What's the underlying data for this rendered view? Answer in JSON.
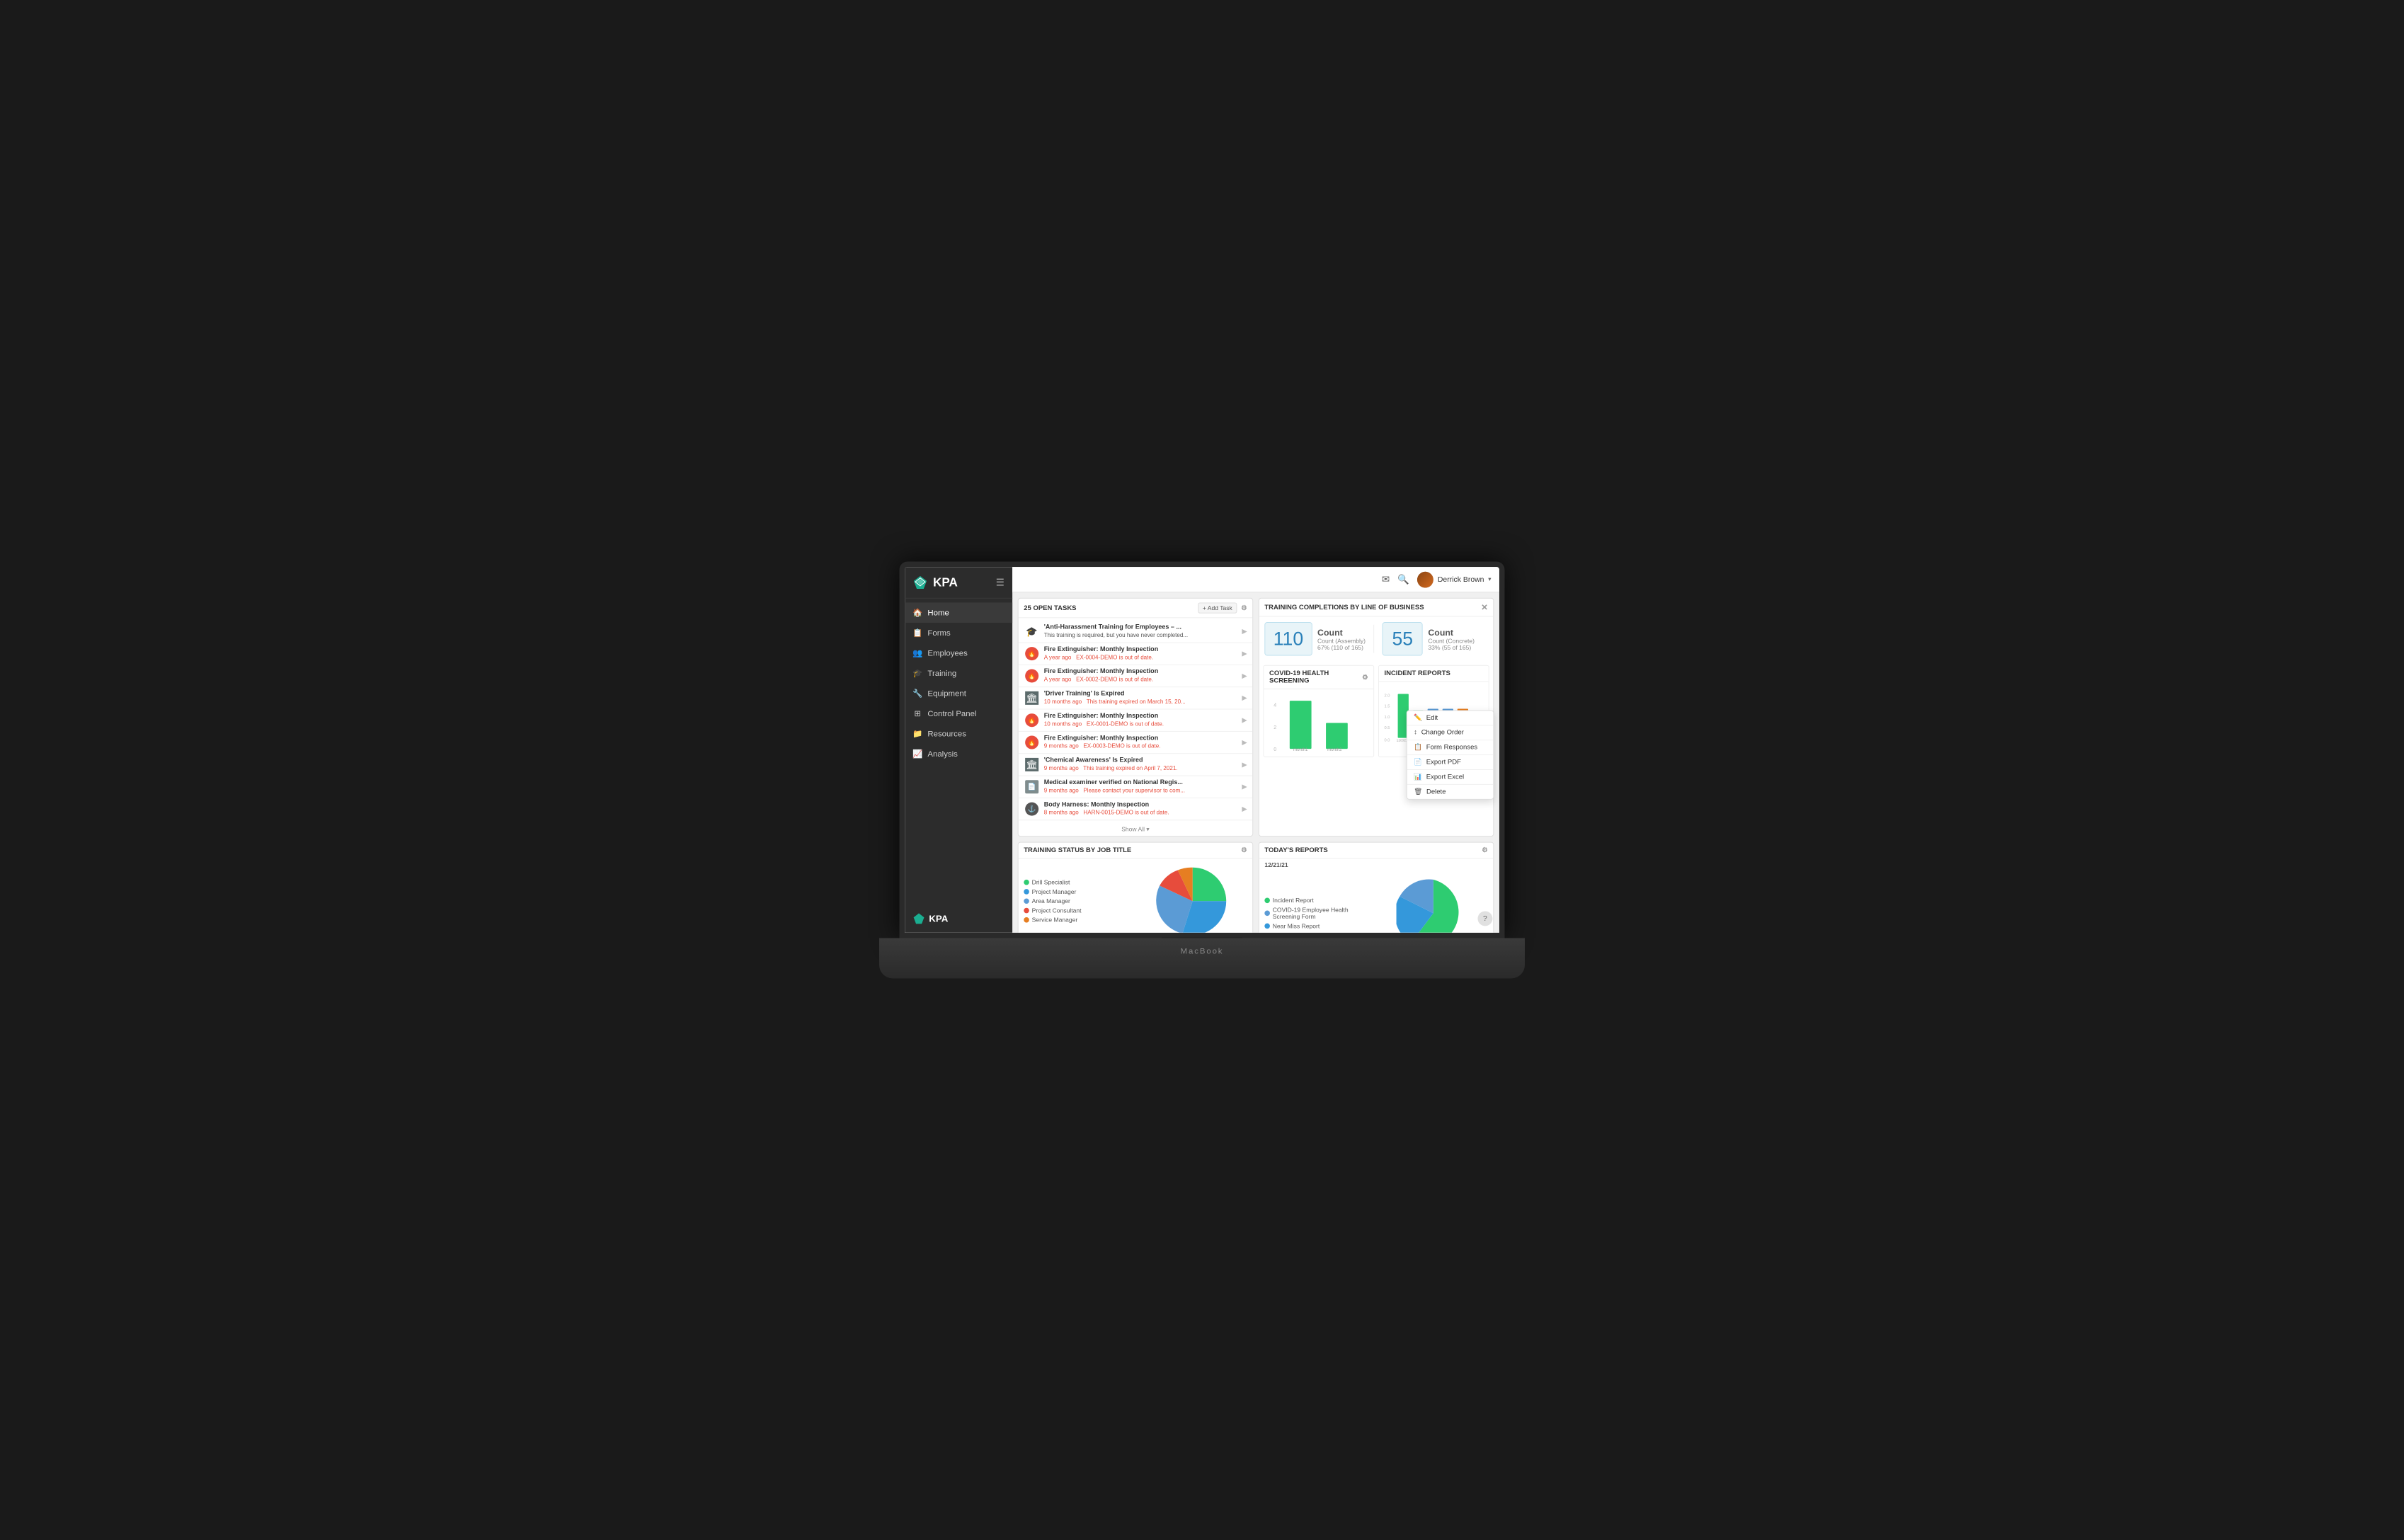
{
  "app": {
    "title": "KPA"
  },
  "header": {
    "user_name": "Derrick Brown",
    "dropdown_arrow": "▾"
  },
  "sidebar": {
    "items": [
      {
        "label": "Home",
        "icon": "🏠",
        "active": true
      },
      {
        "label": "Forms",
        "icon": "📋",
        "active": false
      },
      {
        "label": "Employees",
        "icon": "👥",
        "active": false
      },
      {
        "label": "Training",
        "icon": "🎓",
        "active": false
      },
      {
        "label": "Equipment",
        "icon": "🔧",
        "active": false
      },
      {
        "label": "Control Panel",
        "icon": "⚙️",
        "active": false
      },
      {
        "label": "Resources",
        "icon": "📁",
        "active": false
      },
      {
        "label": "Analysis",
        "icon": "📈",
        "active": false
      }
    ]
  },
  "tasks_widget": {
    "title": "25 OPEN TASKS",
    "add_task_label": "+ Add Task",
    "tasks": [
      {
        "title": "'Anti-Harassment Training for Employees – ...",
        "subtitle": "This training is required, but you have never completed...",
        "icon_type": "training"
      },
      {
        "title": "Fire Extinguisher: Monthly Inspection",
        "subtitle": "A year ago  EX-0004-DEMO is out of date.",
        "icon_type": "fire"
      },
      {
        "title": "Fire Extinguisher: Monthly Inspection",
        "subtitle": "A year ago  EX-0002-DEMO is out of date.",
        "icon_type": "fire"
      },
      {
        "title": "'Driver Training' Is Expired",
        "subtitle": "10 months ago  This training expired on March 15, 20...",
        "icon_type": "building"
      },
      {
        "title": "Fire Extinguisher: Monthly Inspection",
        "subtitle": "10 months ago  EX-0001-DEMO is out of date.",
        "icon_type": "fire"
      },
      {
        "title": "Fire Extinguisher: Monthly Inspection",
        "subtitle": "9 months ago  EX-0003-DEMO is out of date.",
        "icon_type": "fire"
      },
      {
        "title": "'Chemical Awareness' Is Expired",
        "subtitle": "9 months ago  This training expired on April 7, 2021.",
        "icon_type": "building"
      },
      {
        "title": "Medical examiner verified on National Regis...",
        "subtitle": "9 months ago  Please contact your supervisor to com...",
        "icon_type": "doc"
      },
      {
        "title": "Body Harness: Monthly Inspection",
        "subtitle": "8 months ago  HARN-0015-DEMO is out of date.",
        "icon_type": "harness"
      }
    ],
    "show_all_label": "Show All ▾"
  },
  "training_completions": {
    "title": "TRAINING COMPLETIONS BY LINE OF BUSINESS",
    "card1": {
      "number": "110",
      "label": "Count",
      "sub1": "Count (Assembly)",
      "sub2": "67% (110 of 165)"
    },
    "card2": {
      "number": "55",
      "label": "Count",
      "sub1": "Count (Concrete)",
      "sub2": "33% (55 of 165)"
    }
  },
  "covid_widget": {
    "title": "COVID-19 HEALTH SCREENING",
    "bars": [
      {
        "label": "month1",
        "value": 85,
        "color": "#2ecc71"
      },
      {
        "label": "month2",
        "value": 40,
        "color": "#2ecc71"
      }
    ],
    "y_labels": [
      "0",
      "2",
      "4"
    ]
  },
  "incident_widget": {
    "title": "INCIDENT REPORTS",
    "bars": [
      {
        "label": "12/2/21",
        "value": 100,
        "color": "#2ecc71"
      },
      {
        "label": "1/2/21",
        "value": 50,
        "color": "#2ecc71"
      },
      {
        "label": "11/2/21",
        "value": 55,
        "color": "#5b9bd5"
      },
      {
        "label": "10/1/21",
        "value": 55,
        "color": "#5b9bd5"
      },
      {
        "label": "8/14/21",
        "value": 55,
        "color": "#e67e22"
      }
    ],
    "y_labels": [
      "0.0",
      "0.5",
      "1.0",
      "1.5",
      "2.0"
    ]
  },
  "training_status": {
    "title": "TRAINING STATUS BY JOB TITLE",
    "legend": [
      {
        "label": "Drill Specialist",
        "color": "#2ecc71"
      },
      {
        "label": "Project Manager",
        "color": "#3498db"
      },
      {
        "label": "Area Manager",
        "color": "#5b9bd5"
      },
      {
        "label": "Project Consultant",
        "color": "#e74c3c"
      },
      {
        "label": "Service Manager",
        "color": "#e67e22"
      }
    ],
    "pie_segments": [
      {
        "label": "Drill Specialist",
        "color": "#2ecc71",
        "percent": 35
      },
      {
        "label": "Project Manager",
        "color": "#3498db",
        "percent": 20
      },
      {
        "label": "Area Manager",
        "color": "#5b9bd5",
        "percent": 18
      },
      {
        "label": "Project Consultant",
        "color": "#e74c3c",
        "percent": 12
      },
      {
        "label": "Service Manager",
        "color": "#e67e22",
        "percent": 15
      }
    ]
  },
  "todays_reports": {
    "title": "TODAY'S REPORTS",
    "date": "12/21/21",
    "legend": [
      {
        "label": "Incident Report",
        "color": "#2ecc71"
      },
      {
        "label": "COVID-19 Employee Health Screening Form",
        "color": "#5b9bd5"
      },
      {
        "label": "Near Miss Report",
        "color": "#3498db"
      }
    ],
    "pie_segments": [
      {
        "label": "Incident Report",
        "color": "#2ecc71",
        "percent": 55
      },
      {
        "label": "COVID-19",
        "color": "#5b9bd5",
        "percent": 15
      },
      {
        "label": "Near Miss",
        "color": "#3498db",
        "percent": 30
      }
    ]
  },
  "context_menu": {
    "items": [
      {
        "label": "Edit",
        "icon": "✏️"
      },
      {
        "label": "Change Order",
        "icon": "↕️"
      },
      {
        "label": "Form Responses",
        "icon": "📋"
      },
      {
        "label": "Export PDF",
        "icon": "📄"
      },
      {
        "label": "Export Excel",
        "icon": "📊"
      },
      {
        "label": "Delete",
        "icon": "🗑️"
      }
    ]
  },
  "help": {
    "label": "?"
  }
}
